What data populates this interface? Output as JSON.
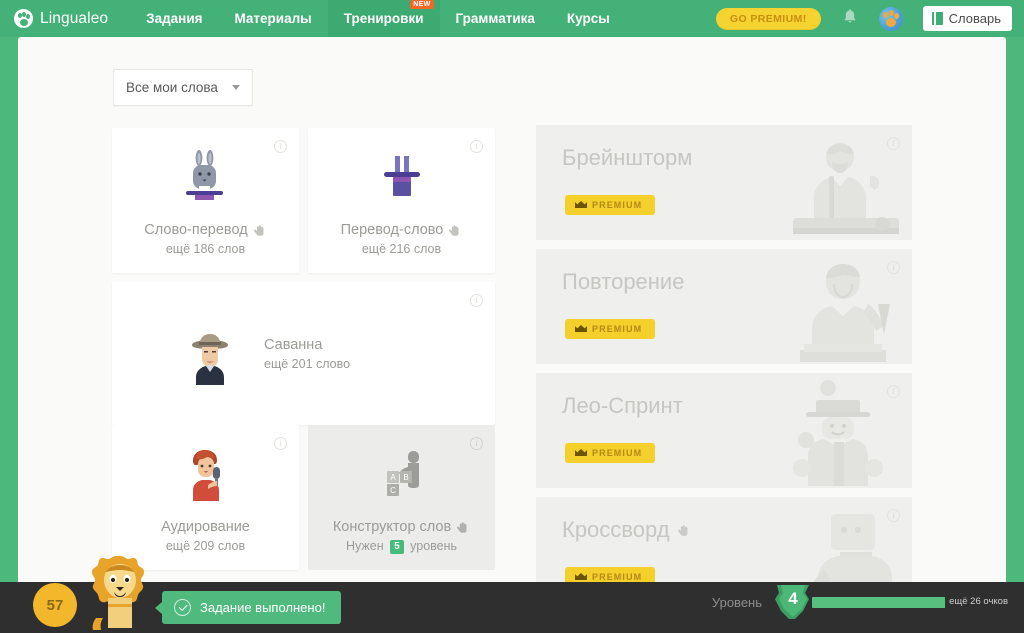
{
  "nav": {
    "brand": "Lingualeo",
    "items": [
      {
        "label": "Задания",
        "active": false,
        "badge": ""
      },
      {
        "label": "Материалы",
        "active": false,
        "badge": ""
      },
      {
        "label": "Тренировки",
        "active": true,
        "badge": "NEW"
      },
      {
        "label": "Грамматика",
        "active": false,
        "badge": ""
      },
      {
        "label": "Курсы",
        "active": false,
        "badge": ""
      }
    ],
    "go_premium": "GO PREMIUM!",
    "dictionary": "Словарь",
    "bell_icon": "bell-icon",
    "avatar_icon": "paw-avatar-icon"
  },
  "filter": {
    "selected": "Все мои слова",
    "caret_icon": "chevron-down-icon"
  },
  "trainings": [
    {
      "id": "word-translation",
      "title": "Слово-перевод",
      "subtitle": "ещё 186 слов",
      "art": "rabbit-in-hat",
      "hand_icon": "swipe-hand-icon",
      "info_icon": "info-icon",
      "locked": false
    },
    {
      "id": "translation-word",
      "title": "Перевод-слово",
      "subtitle": "ещё 216 слов",
      "art": "magic-hat",
      "hand_icon": "swipe-hand-icon",
      "info_icon": "info-icon",
      "locked": false
    },
    {
      "id": "savanna",
      "title": "Саванна",
      "subtitle": "ещё 201 слово",
      "art": "safari-man",
      "hand_icon": "",
      "info_icon": "info-icon",
      "locked": false
    },
    {
      "id": "listening",
      "title": "Аудирование",
      "subtitle": "ещё 209 слов",
      "art": "boy-with-mic",
      "hand_icon": "",
      "info_icon": "info-icon",
      "locked": false
    },
    {
      "id": "word-constructor",
      "title": "Конструктор слов",
      "need_level_prefix": "Нужен",
      "need_level_value": "5",
      "need_level_suffix": "уровень",
      "art": "letter-blocks",
      "hand_icon": "swipe-hand-icon",
      "info_icon": "info-icon",
      "locked": true
    }
  ],
  "premium_trainings": [
    {
      "id": "brainstorm",
      "title": "Брейншторм",
      "badge": "PREMIUM",
      "crown_icon": "crown-icon",
      "info_icon": "info-icon",
      "hand_icon": "",
      "art": "chef-man"
    },
    {
      "id": "repetition",
      "title": "Повторение",
      "badge": "PREMIUM",
      "crown_icon": "crown-icon",
      "info_icon": "info-icon",
      "hand_icon": "",
      "art": "boy-reading"
    },
    {
      "id": "leo-sprint",
      "title": "Лео-Спринт",
      "badge": "PREMIUM",
      "crown_icon": "crown-icon",
      "info_icon": "info-icon",
      "hand_icon": "",
      "art": "juggler"
    },
    {
      "id": "crossword",
      "title": "Кроссворд",
      "badge": "PREMIUM",
      "crown_icon": "crown-icon",
      "info_icon": "info-icon",
      "hand_icon": "swipe-hand-icon",
      "art": "thinking-man"
    }
  ],
  "statusbar": {
    "xp_value": "57",
    "mascot_icon": "leo-lion-mascot",
    "toast": "Задание выполнено!",
    "toast_check_icon": "check-circle-icon",
    "level_label": "Уровень",
    "level_value": "4",
    "points_remaining": "ещё 26 очков",
    "progress_percent": 93
  },
  "colors": {
    "brand_green": "#43b178",
    "page_green": "#4cb87c",
    "panel": "#fafaf8",
    "premium_yellow": "#f5cf2a",
    "bar_dark": "#2f2f30",
    "toast_green": "#50b97e"
  }
}
